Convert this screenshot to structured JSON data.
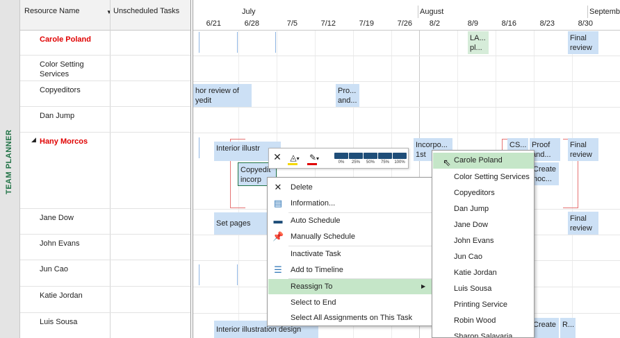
{
  "side_label": "TEAM PLANNER",
  "grid_header": {
    "resource_name": "Resource Name",
    "unscheduled": "Unscheduled Tasks"
  },
  "timeline": {
    "months": [
      "July",
      "August",
      "Septemb"
    ],
    "dates": [
      "6/21",
      "6/28",
      "7/5",
      "7/12",
      "7/19",
      "7/26",
      "8/2",
      "8/9",
      "8/16",
      "8/23",
      "8/30"
    ]
  },
  "resources": [
    {
      "name": "Carole Poland"
    },
    {
      "name": "Color Setting Services"
    },
    {
      "name": "Copyeditors"
    },
    {
      "name": "Dan Jump"
    },
    {
      "name": "Hany Morcos"
    },
    {
      "name": "Jane Dow"
    },
    {
      "name": "John Evans"
    },
    {
      "name": "Jun Cao"
    },
    {
      "name": "Katie Jordan"
    },
    {
      "name": "Luis Sousa"
    }
  ],
  "bars": {
    "carole_la": "LA...\npl...",
    "carole_final": "Final\nreview",
    "copy_hor": "hor review of\nyedit",
    "copy_pro": "Pro...\nand...",
    "hany_interior": "Interior illustr",
    "hany_copyedit": "Copyedit\nincorp",
    "hany_incorpo": "Incorpo...\n1st",
    "hany_cs": "CS...",
    "hany_proof": "Proof\nand...",
    "hany_final": "Final\nreview",
    "hany_create": "Create\nnoc...",
    "jane_set": "Set pages",
    "jane_final": "Final\nreview",
    "luis_interior": "Interior illustration design",
    "luis_create": "Create",
    "luis_r": "R..."
  },
  "mini_toolbar": {
    "pct": [
      "0%",
      "25%",
      "50%",
      "75%",
      "100%"
    ]
  },
  "context_menu": [
    {
      "label": "Delete",
      "icon": "delete-icon"
    },
    {
      "label": "Information...",
      "icon": "information-icon"
    },
    {
      "label": "Auto Schedule",
      "icon": "auto-schedule-icon"
    },
    {
      "label": "Manually Schedule",
      "icon": "pin-icon"
    },
    {
      "label": "Inactivate Task",
      "icon": ""
    },
    {
      "label": "Add to Timeline",
      "icon": "timeline-icon"
    },
    {
      "label": "Reassign To",
      "icon": ""
    },
    {
      "label": "Select to End",
      "icon": ""
    },
    {
      "label": "Select All Assignments on This Task",
      "icon": ""
    }
  ],
  "submenu": [
    "Carole Poland",
    "Color Setting Services",
    "Copyeditors",
    "Dan Jump",
    "Jane Dow",
    "John Evans",
    "Jun Cao",
    "Katie Jordan",
    "Luis Sousa",
    "Printing Service",
    "Robin Wood",
    "Sharon Salavaria"
  ],
  "colors": {
    "accent_green": "#217346",
    "bar_blue": "#cce0f5",
    "highlight": "#c5e6c8",
    "overalloc_red": "#e00000"
  }
}
